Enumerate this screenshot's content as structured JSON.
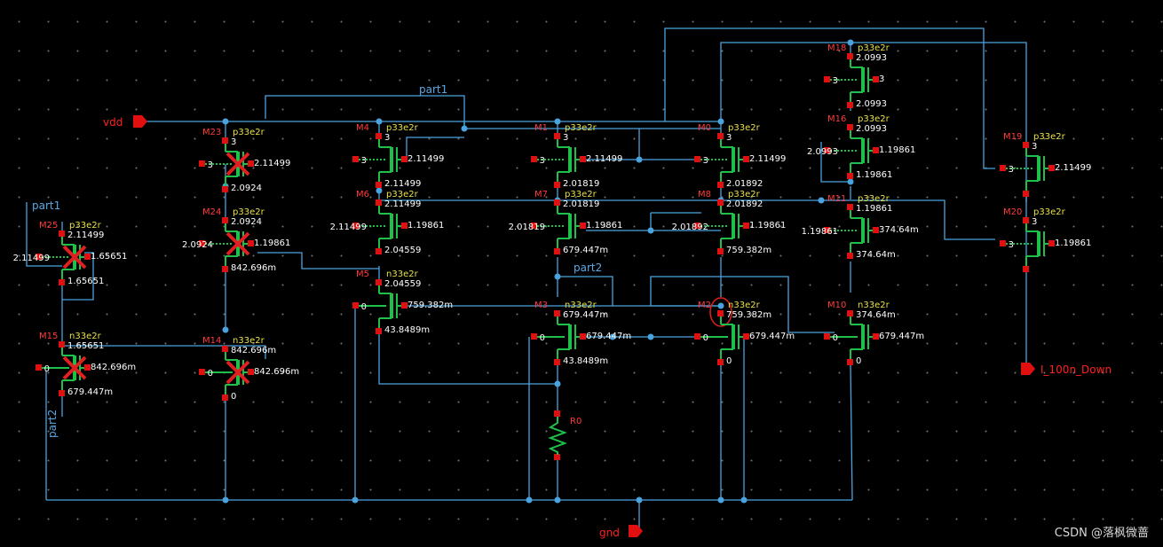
{
  "pins": {
    "vdd": "vdd",
    "gnd": "gnd",
    "out": "I_100n_Down"
  },
  "nets": {
    "part1": "part1",
    "part2": "part2"
  },
  "devices": [
    {
      "id": "M23",
      "model": "p33e2r",
      "vals": [
        "3",
        "2.11499",
        "3",
        "2.0924"
      ]
    },
    {
      "id": "M24",
      "model": "p33e2r",
      "vals": [
        "2.0924",
        "1.19861",
        "2.0924",
        "842.696m"
      ]
    },
    {
      "id": "M25",
      "model": "p33e2r",
      "vals": [
        "2.11499",
        "1.65651",
        "2.11499",
        "1.65651"
      ]
    },
    {
      "id": "M15",
      "model": "n33e2r",
      "vals": [
        "1.65651",
        "842.696m",
        "0",
        "679.447m"
      ]
    },
    {
      "id": "M14",
      "model": "n33e2r",
      "vals": [
        "842.696m",
        "842.696m",
        "0",
        "0"
      ]
    },
    {
      "id": "M4",
      "model": "p33e2r",
      "vals": [
        "3",
        "2.11499",
        "3",
        "2.11499"
      ]
    },
    {
      "id": "M6",
      "model": "p33e2r",
      "vals": [
        "2.11499",
        "1.19861",
        "2.11499",
        "2.04559"
      ]
    },
    {
      "id": "M5",
      "model": "n33e2r",
      "vals": [
        "2.04559",
        "759.382m",
        "0",
        "43.8489m"
      ]
    },
    {
      "id": "M1",
      "model": "p33e2r",
      "vals": [
        "3",
        "2.11499",
        "3",
        "2.01819"
      ]
    },
    {
      "id": "M7",
      "model": "p33e2r",
      "vals": [
        "2.01819",
        "1.19861",
        "2.01819",
        "679.447m"
      ]
    },
    {
      "id": "M3",
      "model": "n33e2r",
      "vals": [
        "679.447m",
        "679.447m",
        "0",
        "43.8489m"
      ]
    },
    {
      "id": "M0",
      "model": "p33e2r",
      "vals": [
        "3",
        "2.11499",
        "3",
        "2.01892"
      ]
    },
    {
      "id": "M8",
      "model": "p33e2r",
      "vals": [
        "2.01892",
        "1.19861",
        "2.01892",
        "759.382m"
      ]
    },
    {
      "id": "M2",
      "model": "n33e2r",
      "vals": [
        "759.382m",
        "679.447m",
        "0",
        "0"
      ]
    },
    {
      "id": "M18",
      "model": "p33e2r",
      "vals": [
        "2.0993",
        "3",
        "3",
        "2.0993"
      ]
    },
    {
      "id": "M16",
      "model": "p33e2r",
      "vals": [
        "2.0993",
        "1.19861",
        "2.0993",
        "1.19861"
      ]
    },
    {
      "id": "M11",
      "model": "p33e2r",
      "vals": [
        "1.19861",
        "374.64m",
        "1.19861",
        "374.64m"
      ]
    },
    {
      "id": "M10",
      "model": "n33e2r",
      "vals": [
        "374.64m",
        "679.447m",
        "0",
        "0"
      ]
    },
    {
      "id": "M19",
      "model": "p33e2r",
      "vals": [
        "3",
        "2.11499",
        "3",
        ""
      ]
    },
    {
      "id": "M20",
      "model": "p33e2r",
      "vals": [
        "3",
        "1.19861",
        "3",
        ""
      ]
    }
  ],
  "resistor": {
    "id": "R0"
  },
  "watermark": "CSDN @落枫微蔷"
}
